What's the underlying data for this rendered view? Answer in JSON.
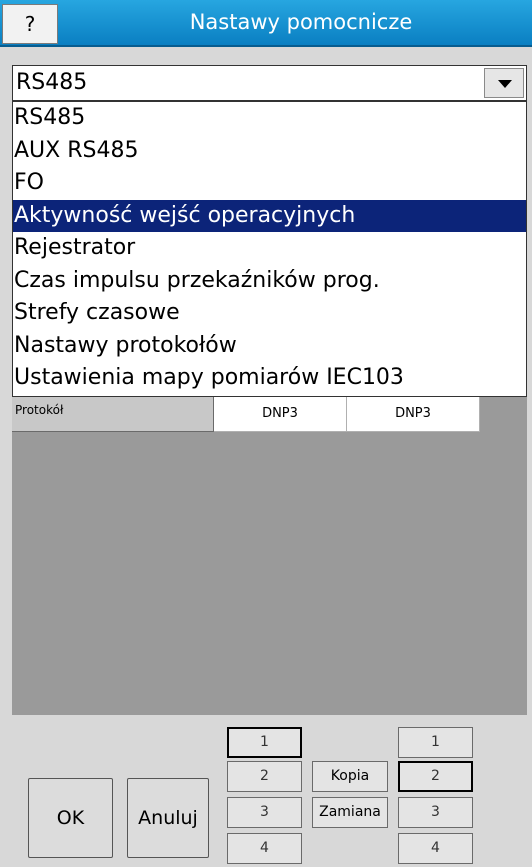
{
  "titlebar": {
    "help_label": "?",
    "title": "Nastawy pomocnicze"
  },
  "combo": {
    "value": "RS485",
    "icon": "chevron-down-icon"
  },
  "dropdown": {
    "items": [
      "RS485",
      "AUX RS485",
      "FO",
      "Aktywność wejść operacyjnych",
      "Rejestrator",
      "Czas impulsu przekaźników prog.",
      "Strefy czasowe",
      "Nastawy protokołów",
      "Ustawienia mapy pomiarów IEC103"
    ],
    "selected": "Aktywność wejść operacyjnych",
    "selected_color": "#0c2479"
  },
  "grid": {
    "label": "Protokół",
    "values": [
      "DNP3",
      "DNP3"
    ]
  },
  "footer": {
    "ok_label": "OK",
    "cancel_label": "Anuluj",
    "copy_label": "Kopia",
    "swap_label": "Zamiana",
    "left_banks": [
      "1",
      "2",
      "3",
      "4"
    ],
    "right_banks": [
      "1",
      "2",
      "3",
      "4"
    ],
    "left_active": "1",
    "right_active": "2"
  },
  "colors": {
    "titlebar": "#1a93d3",
    "workarea": "#9a9a9a"
  }
}
